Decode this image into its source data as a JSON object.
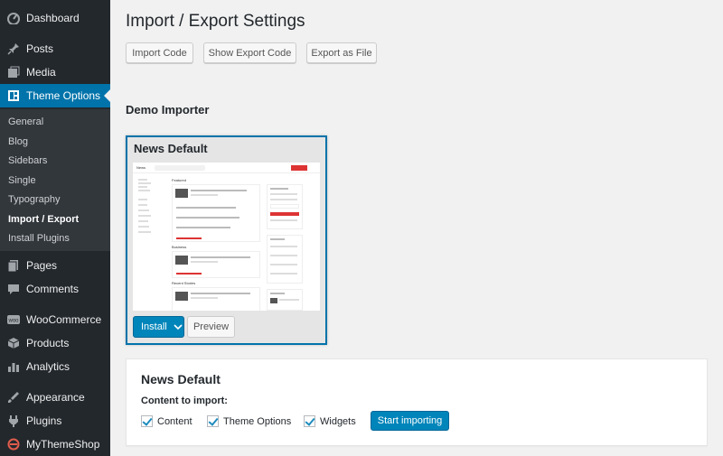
{
  "sidebar": {
    "items": [
      {
        "label": "Dashboard",
        "icon": "dashboard-icon"
      },
      {
        "label": "Posts",
        "icon": "pin-icon"
      },
      {
        "label": "Media",
        "icon": "media-icon"
      },
      {
        "label": "Theme Options",
        "icon": "theme-options-icon"
      },
      {
        "label": "Pages",
        "icon": "pages-icon"
      },
      {
        "label": "Comments",
        "icon": "comments-icon"
      },
      {
        "label": "WooCommerce",
        "icon": "woocommerce-icon"
      },
      {
        "label": "Products",
        "icon": "products-icon"
      },
      {
        "label": "Analytics",
        "icon": "analytics-icon"
      },
      {
        "label": "Appearance",
        "icon": "appearance-icon"
      },
      {
        "label": "Plugins",
        "icon": "plugins-icon"
      },
      {
        "label": "MyThemeShop",
        "icon": "mythemeshop-icon"
      }
    ],
    "submenu": [
      "General",
      "Blog",
      "Sidebars",
      "Single",
      "Typography",
      "Import / Export",
      "Install Plugins"
    ],
    "active_item": "Theme Options",
    "current_sub": "Import / Export"
  },
  "main": {
    "title": "Import / Export Settings",
    "buttons": {
      "import_code": "Import Code",
      "show_export": "Show Export Code",
      "export_file": "Export as File"
    },
    "demo_section_title": "Demo Importer",
    "demo_card": {
      "title": "News Default",
      "install_label": "Install",
      "preview_label": "Preview",
      "thumb": {
        "logo": "News",
        "section_featured": "Featured",
        "section_business": "Business",
        "section_recent": "Recent Stories"
      }
    },
    "import_panel": {
      "title": "News Default",
      "content_label": "Content to import:",
      "options": [
        {
          "label": "Content",
          "checked": true
        },
        {
          "label": "Theme Options",
          "checked": true
        },
        {
          "label": "Widgets",
          "checked": true
        }
      ],
      "start_label": "Start importing"
    }
  },
  "colors": {
    "sidebar_bg": "#23282d",
    "accent": "#0073aa",
    "button_primary": "#0085ba"
  }
}
